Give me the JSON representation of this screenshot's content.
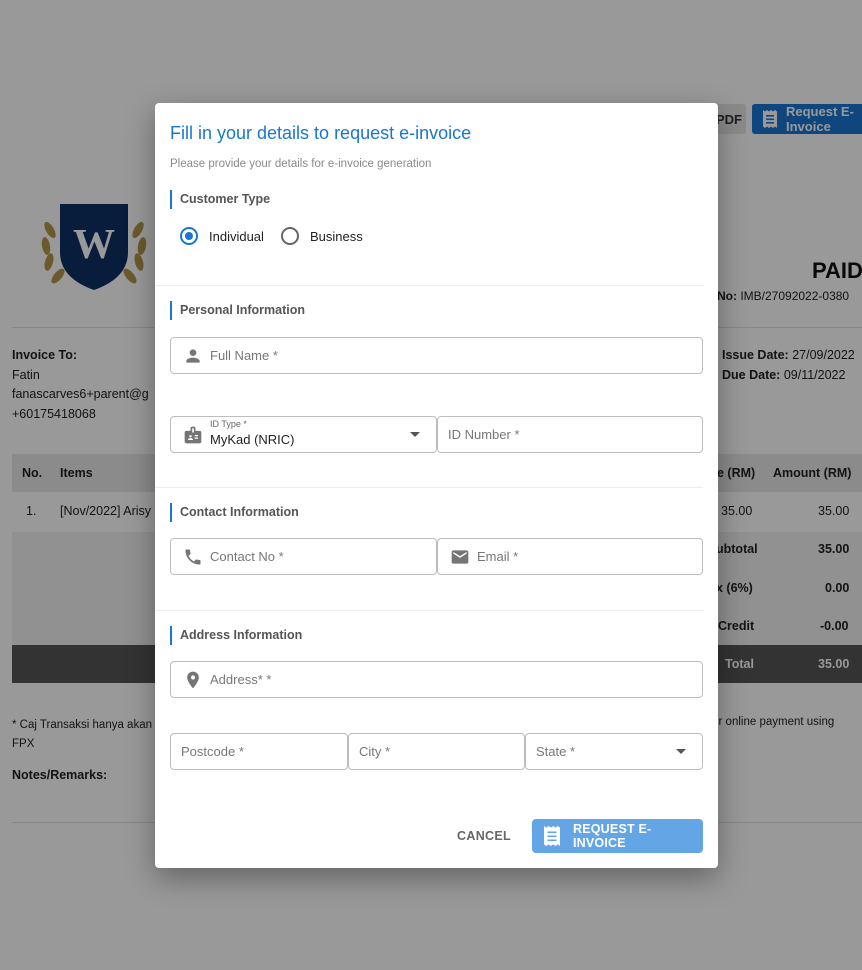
{
  "background": {
    "pdf_label": "PDF",
    "request_label": "Request E-Invoice",
    "status": "PAID",
    "invoice_no_label": "No:",
    "invoice_no": "IMB/27092022-0380",
    "invoice_to_label": "Invoice To:",
    "customer_name": "Fatin",
    "customer_email": "fanascarves6+parent@g",
    "customer_phone": "+60175418068",
    "issue_date_label": "Issue Date:",
    "issue_date": "27/09/2022",
    "due_date_label": "Due Date:",
    "due_date": "09/11/2022",
    "table": {
      "col_no": "No.",
      "col_items": "Items",
      "col_price": "e (RM)",
      "col_amount": "Amount (RM)",
      "row_no": "1.",
      "row_item": "[Nov/2022] Arisy",
      "row_price": "35.00",
      "row_amount": "35.00"
    },
    "summary": {
      "subtotal_label": "ubtotal",
      "subtotal": "35.00",
      "tax_label": "x (6%)",
      "tax": "0.00",
      "credit_label": "Credit",
      "credit": "-0.00",
      "total_label": "Total",
      "total": "35.00"
    },
    "note_left": "* Caj Transaksi hanya akan",
    "note_left_2": "FPX",
    "note_right": "y for online payment using",
    "remarks_label": "Notes/Remarks:"
  },
  "dialog": {
    "title": "Fill in your details to request e-invoice",
    "subtitle": "Please provide your details for e-invoice generation",
    "customer_type": {
      "heading": "Customer Type",
      "options": [
        "Individual",
        "Business"
      ],
      "selected": "Individual"
    },
    "personal": {
      "heading": "Personal Information",
      "full_name_placeholder": "Full Name *",
      "id_type_label": "ID Type *",
      "id_type_value": "MyKad (NRIC)",
      "id_number_placeholder": "ID Number *"
    },
    "contact": {
      "heading": "Contact Information",
      "contact_placeholder": "Contact No *",
      "email_placeholder": "Email *"
    },
    "address": {
      "heading": "Address Information",
      "address_placeholder": "Address* *",
      "postcode_placeholder": "Postcode *",
      "city_placeholder": "City *",
      "state_placeholder": "State *"
    },
    "cancel_label": "CANCEL",
    "submit_label": "REQUEST E-INVOICE",
    "accent_color": "#1976d2",
    "submit_color": "#64a5e6"
  },
  "icons": [
    "person-icon",
    "id-card-icon",
    "phone-icon",
    "email-icon",
    "location-icon",
    "receipt-icon",
    "chevron-down-icon"
  ]
}
